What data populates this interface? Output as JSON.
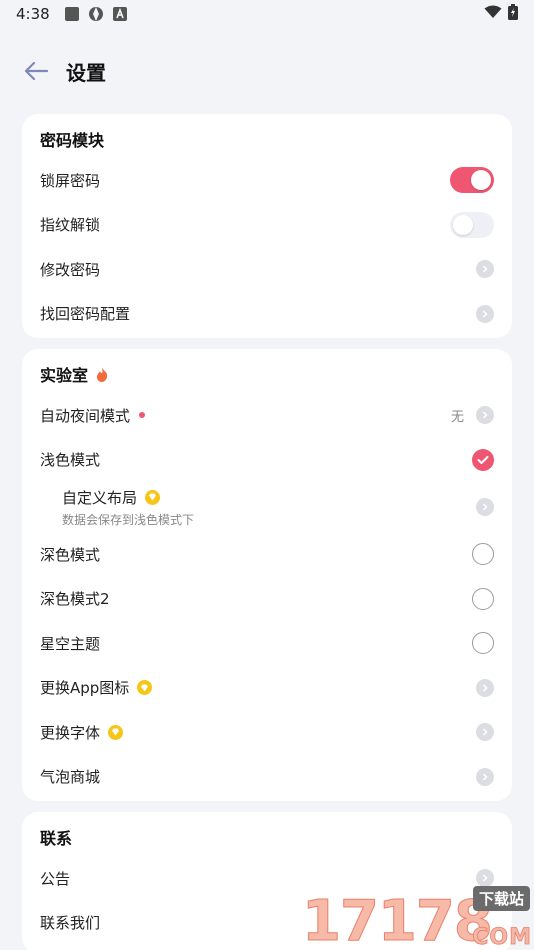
{
  "status_bar": {
    "time": "4:38"
  },
  "header": {
    "title": "设置"
  },
  "sections": {
    "password": {
      "title": "密码模块",
      "lock_screen": "锁屏密码",
      "fingerprint": "指纹解锁",
      "change_password": "修改密码",
      "recover_config": "找回密码配置"
    },
    "lab": {
      "title": "实验室",
      "auto_night": "自动夜间模式",
      "auto_night_value": "无",
      "light_mode": "浅色模式",
      "custom_layout": "自定义布局",
      "custom_layout_sub": "数据会保存到浅色模式下",
      "dark_mode": "深色模式",
      "dark_mode2": "深色模式2",
      "starry_theme": "星空主题",
      "change_app_icon": "更换App图标",
      "change_font": "更换字体",
      "bubble_store": "气泡商城"
    },
    "contact": {
      "title": "联系",
      "announcement": "公告",
      "contact_us": "联系我们"
    }
  },
  "watermark": {
    "digits": "17178",
    "label": "下载站",
    "domain": "COM"
  },
  "colors": {
    "accent": "#ee5672",
    "background": "#f3f4f8",
    "vip": "#f5c518"
  }
}
